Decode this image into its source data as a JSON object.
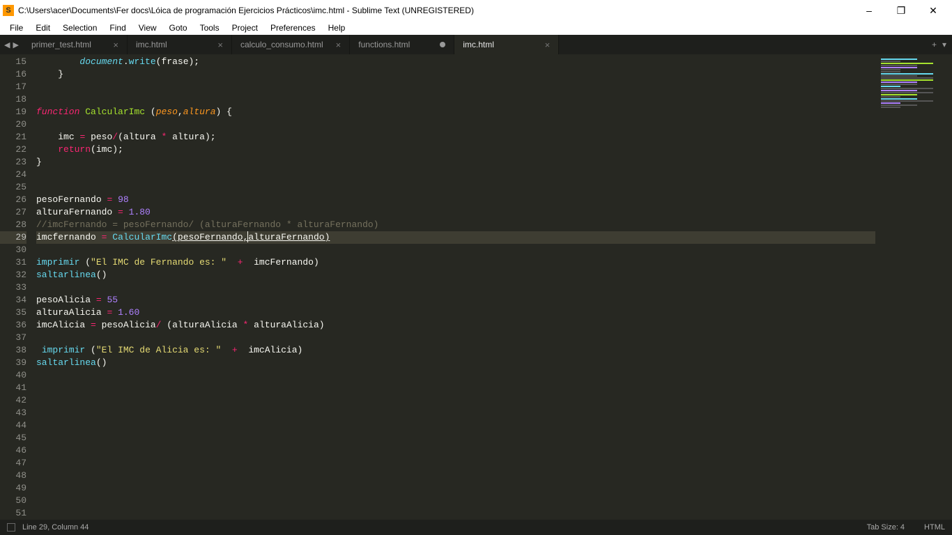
{
  "titlebar": {
    "title": "C:\\Users\\acer\\Documents\\Fer docs\\Lóica de programación Ejercicios Prácticos\\imc.html - Sublime Text (UNREGISTERED)"
  },
  "menu": {
    "items": [
      "File",
      "Edit",
      "Selection",
      "Find",
      "View",
      "Goto",
      "Tools",
      "Project",
      "Preferences",
      "Help"
    ]
  },
  "tabs": [
    {
      "label": "primer_test.html",
      "dirty": false,
      "active": false
    },
    {
      "label": "imc.html",
      "dirty": false,
      "active": false
    },
    {
      "label": "calculo_consumo.html",
      "dirty": false,
      "active": false
    },
    {
      "label": "functions.html",
      "dirty": true,
      "active": false
    },
    {
      "label": "imc.html",
      "dirty": false,
      "active": true
    }
  ],
  "editor": {
    "first_line": 15,
    "last_line": 51,
    "current_line": 29
  },
  "statusbar": {
    "position": "Line 29, Column 44",
    "tabsize": "Tab Size: 4",
    "syntax": "HTML"
  }
}
